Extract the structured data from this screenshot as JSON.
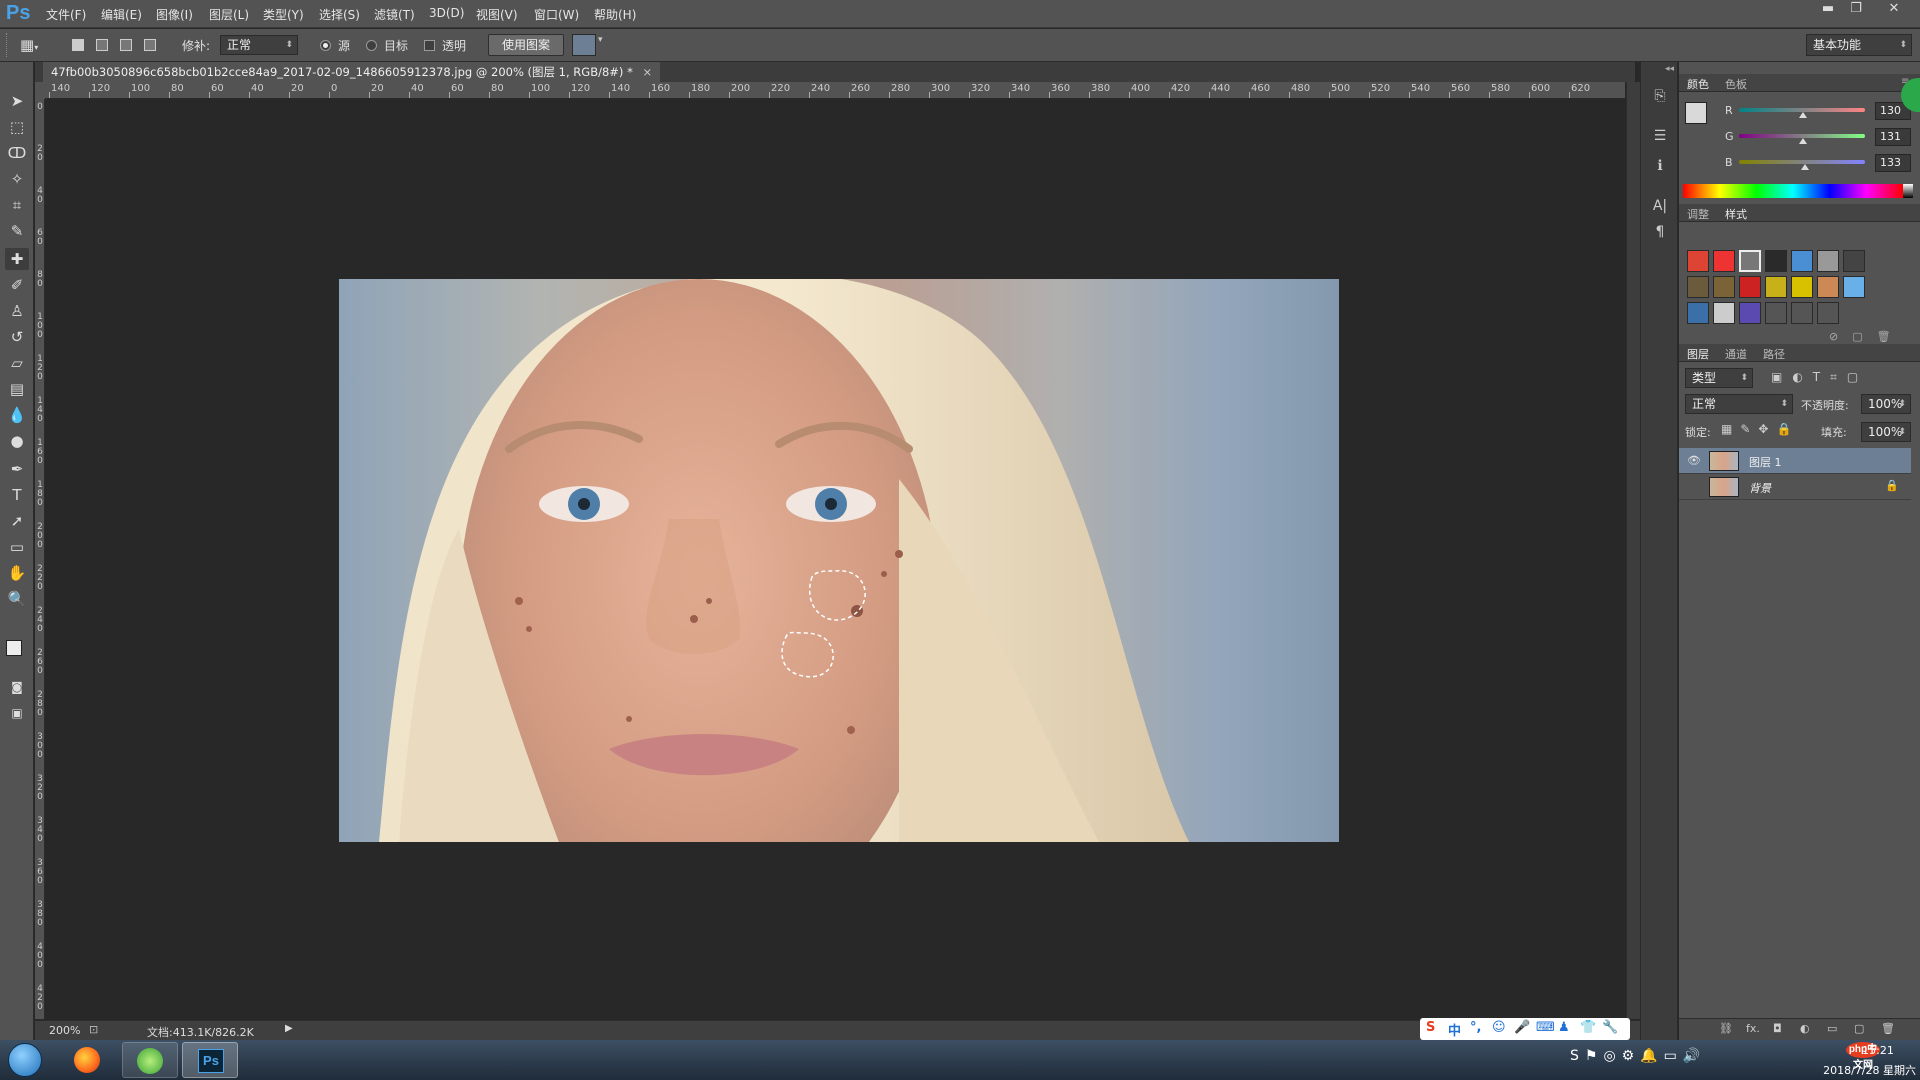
{
  "app": {
    "logo": "Ps"
  },
  "menu": {
    "items": [
      "文件(F)",
      "编辑(E)",
      "图像(I)",
      "图层(L)",
      "类型(Y)",
      "选择(S)",
      "滤镜(T)",
      "3D(D)",
      "视图(V)",
      "窗口(W)",
      "帮助(H)"
    ],
    "window_controls": [
      "▬",
      "❐",
      "✕"
    ]
  },
  "options": {
    "patch_label": "修补:",
    "patch_mode": "正常",
    "source_label": "源",
    "target_label": "目标",
    "transparent_label": "透明",
    "use_pattern_label": "使用图案",
    "workspace": "基本功能"
  },
  "document": {
    "tab_title": "47fb00b3050896c658bcb01b2cce84a9_2017-02-09_1486605912378.jpg @ 200% (图层 1, RGB/8#) *",
    "close": "×"
  },
  "ruler_h": [
    "140",
    "120",
    "100",
    "80",
    "60",
    "40",
    "20",
    "0",
    "20",
    "40",
    "60",
    "80",
    "100",
    "120",
    "140",
    "160",
    "180",
    "200",
    "220",
    "240",
    "260",
    "280",
    "300",
    "320",
    "340",
    "360",
    "380",
    "400",
    "420",
    "440",
    "460",
    "480",
    "500",
    "520",
    "540",
    "560",
    "580",
    "600",
    "620"
  ],
  "ruler_v": [
    "0",
    "20",
    "40",
    "60",
    "80",
    "100",
    "120",
    "140",
    "160",
    "180",
    "200",
    "220",
    "240",
    "260",
    "280",
    "300",
    "320",
    "340",
    "360",
    "380",
    "400",
    "420"
  ],
  "status": {
    "zoom": "200%",
    "doc": "文档:413.1K/826.2K"
  },
  "color_panel": {
    "tabs": [
      "颜色",
      "色板"
    ],
    "channels": [
      {
        "label": "R",
        "value": "130",
        "level": 0.51
      },
      {
        "label": "G",
        "value": "131",
        "level": 0.51
      },
      {
        "label": "B",
        "value": "133",
        "level": 0.52
      }
    ]
  },
  "styles_panel": {
    "tabs": [
      "调整",
      "样式"
    ]
  },
  "layers_panel": {
    "tabs": [
      "图层",
      "通道",
      "路径"
    ],
    "filter_kind": "类型",
    "blend_mode": "正常",
    "opacity_label": "不透明度:",
    "opacity": "100%",
    "lock_label": "锁定:",
    "fill_label": "填充:",
    "fill": "100%",
    "layers": [
      {
        "name": "图层 1",
        "visible": true,
        "selected": true
      },
      {
        "name": "背景",
        "visible": false,
        "selected": false
      }
    ],
    "bottom_icons": [
      "⛓",
      "fx.",
      "◘",
      "◐",
      "▭",
      "▢",
      "🗑"
    ]
  },
  "ime": {
    "items": [
      "S",
      "中",
      "°,",
      "☺",
      "🎤",
      "⌨",
      "♟",
      "👕",
      "🔧"
    ]
  },
  "taskbar": {
    "time": "15:21",
    "date": "2018/7/28 星期六",
    "php_badge": "php中文网"
  },
  "colors": {
    "accent": "#4aa3e8",
    "panel": "#535353",
    "canvas": "#282828"
  }
}
